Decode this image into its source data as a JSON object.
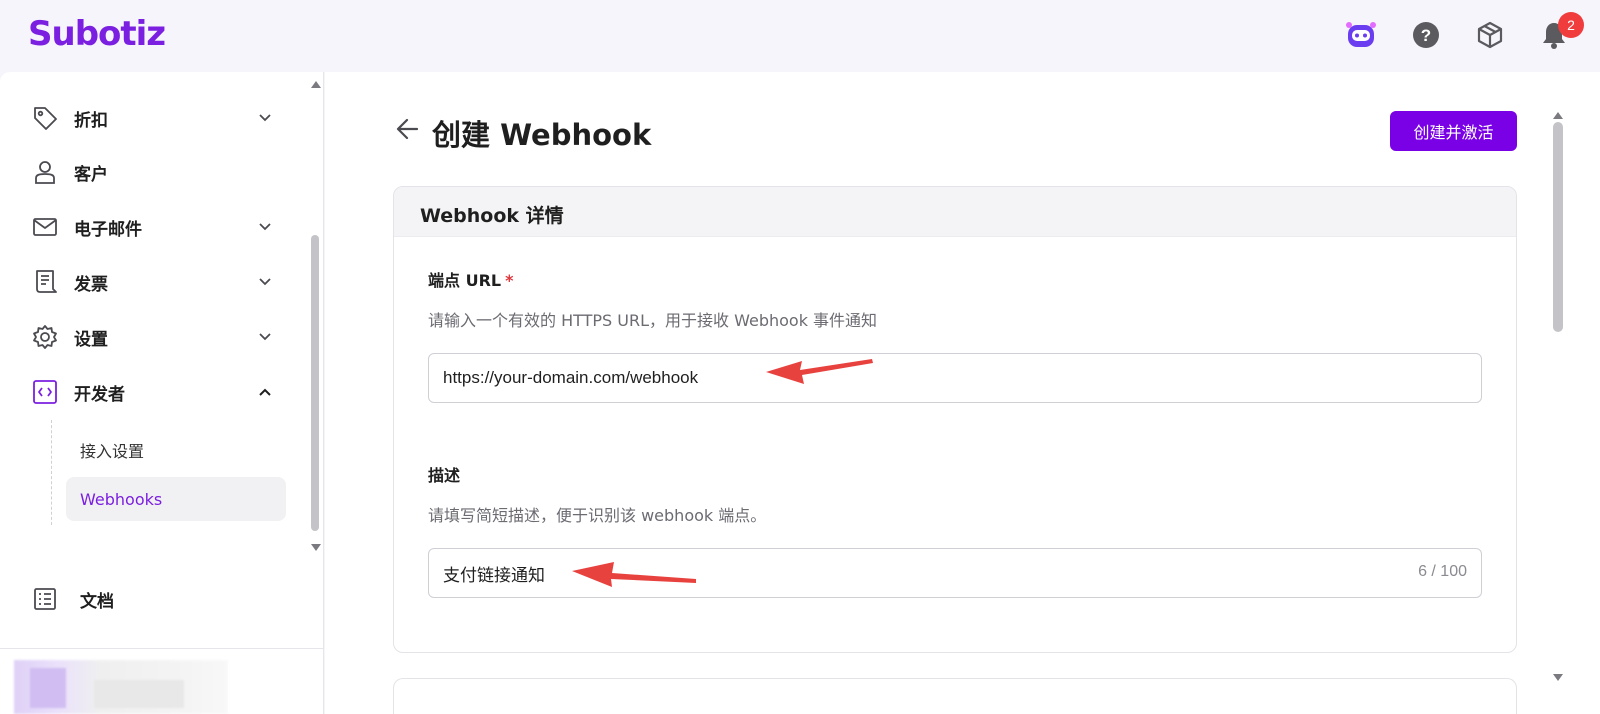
{
  "header": {
    "logo": "Subotiz",
    "icons": [
      "assistant-bot-icon",
      "help-icon",
      "package-icon",
      "bell-icon"
    ],
    "notification_count": "2"
  },
  "sidebar": {
    "items": [
      {
        "label": "折扣",
        "icon": "tag-icon",
        "expanded": false
      },
      {
        "label": "客户",
        "icon": "user-icon"
      },
      {
        "label": "电子邮件",
        "icon": "mail-icon",
        "expanded": false
      },
      {
        "label": "发票",
        "icon": "receipt-icon",
        "expanded": false
      },
      {
        "label": "设置",
        "icon": "gear-icon",
        "expanded": false
      },
      {
        "label": "开发者",
        "icon": "code-icon",
        "expanded": true
      }
    ],
    "sub_items": [
      {
        "label": "接入设置",
        "active": false
      },
      {
        "label": "Webhooks",
        "active": true
      }
    ],
    "docs_label": "文档"
  },
  "main": {
    "title": "创建 Webhook",
    "primary_button": "创建并激活",
    "card_title": "Webhook 详情",
    "endpoint": {
      "label": "端点 URL",
      "required_mark": "*",
      "hint": "请输入一个有效的 HTTPS URL，用于接收 Webhook 事件通知",
      "value": "https://your-domain.com/webhook"
    },
    "description": {
      "label": "描述",
      "hint": "请填写简短描述，便于识别该 webhook 端点。",
      "value": "支付链接通知",
      "counter": "6 / 100"
    }
  },
  "colors": {
    "brand": "#7b1fe0",
    "primary_button": "#7a00e6",
    "badge": "#f03c3c",
    "annotation_arrow": "#e8423f"
  }
}
